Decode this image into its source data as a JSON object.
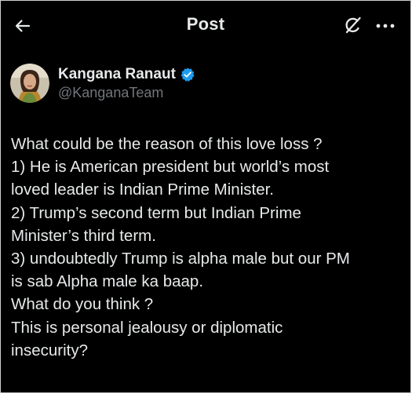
{
  "header": {
    "title": "Post"
  },
  "author": {
    "name": "Kangana Ranaut",
    "handle": "@KanganaTeam"
  },
  "post": {
    "lines": [
      "What could be the reason of this love loss ?",
      "1) He is American president but world’s most",
      "loved leader is Indian Prime Minister.",
      "2) Trump’s second term but Indian Prime",
      "Minister’s third term.",
      "3) undoubtedly Trump is alpha male but our PM",
      "is sab Alpha male ka baap.",
      "What do you think ?",
      "This is personal jealousy or diplomatic",
      "insecurity?"
    ]
  },
  "icons": {
    "back": "arrow-left-icon",
    "grok": "grok-icon",
    "more": "more-horizontal-icon",
    "verified": "verified-badge-icon"
  },
  "colors": {
    "background": "#000000",
    "text": "#e7e9ea",
    "secondary_text": "#71767b",
    "verified": "#1d9bf0"
  }
}
